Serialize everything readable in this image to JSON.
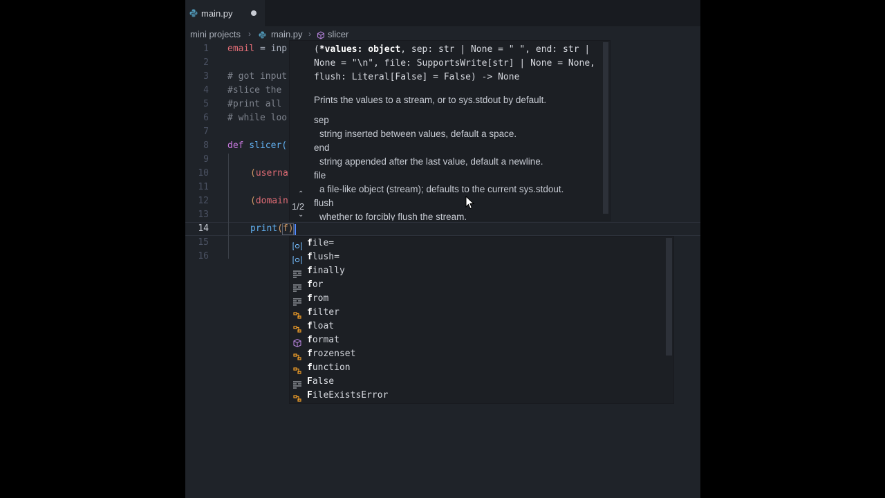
{
  "tab": {
    "title": "main.py"
  },
  "breadcrumb": {
    "folder": "mini projects",
    "file": "main.py",
    "symbol": "slicer"
  },
  "gutter": [
    "1",
    "2",
    "3",
    "4",
    "5",
    "6",
    "7",
    "8",
    "9",
    "10",
    "11",
    "12",
    "13",
    "14",
    "15",
    "16"
  ],
  "code": {
    "l1_var": "email",
    "l1_rest": " = inp",
    "l3": "# got input",
    "l4": "#slice the",
    "l5": "#print all",
    "l6": "# while loo",
    "l8_kw": "def",
    "l8_fn": " slicer(",
    "l10_p": "(",
    "l10_v": "userna",
    "l12_p": "(",
    "l12_v": "domain",
    "l14_fn": "print",
    "l14_p": "(",
    "l14_f": "f",
    "l14_close": ")"
  },
  "signature": {
    "l1a": "(",
    "l1b": "*values: object",
    "l1c": ", sep: str | None = \" \", end: str |",
    "l2": "None = \"\\n\", file: SupportsWrite[str] | None = None,",
    "l3": "flush: Literal[False] = False) -> None",
    "summary": "Prints the values to a stream, or to sys.stdout by default.",
    "params": [
      {
        "name": "sep",
        "desc": "string inserted between values, default a space."
      },
      {
        "name": "end",
        "desc": "string appended after the last value, default a newline."
      },
      {
        "name": "file",
        "desc": "a file-like object (stream); defaults to the current sys.stdout."
      },
      {
        "name": "flush",
        "desc": "whether to forcibly flush the stream."
      }
    ],
    "counter": "1/2"
  },
  "suggestions": [
    {
      "m": "f",
      "rest": "ile=",
      "icon": "variable-icon"
    },
    {
      "m": "f",
      "rest": "lush=",
      "icon": "variable-icon"
    },
    {
      "m": "f",
      "rest": "inally",
      "icon": "keyword-icon"
    },
    {
      "m": "f",
      "rest": "or",
      "icon": "keyword-icon"
    },
    {
      "m": "f",
      "rest": "rom",
      "icon": "keyword-icon"
    },
    {
      "m": "f",
      "rest": "ilter",
      "icon": "class-icon"
    },
    {
      "m": "f",
      "rest": "loat",
      "icon": "class-icon"
    },
    {
      "m": "f",
      "rest": "ormat",
      "icon": "method-icon"
    },
    {
      "m": "f",
      "rest": "rozenset",
      "icon": "class-icon"
    },
    {
      "m": "f",
      "rest": "unction",
      "icon": "class-icon"
    },
    {
      "m": "F",
      "rest": "alse",
      "icon": "keyword-icon"
    },
    {
      "m": "F",
      "rest": "ileExistsError",
      "icon": "class-icon"
    }
  ],
  "colors": {
    "accent": "#528bff",
    "class_icon": "#ee9d28",
    "method_icon": "#b180d7",
    "variable_icon": "#75beff"
  }
}
